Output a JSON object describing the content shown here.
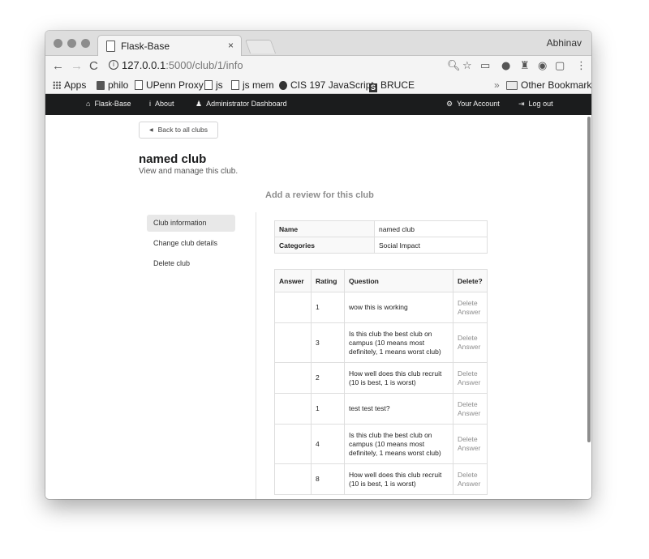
{
  "browser": {
    "tab_title": "Flask-Base",
    "tab_close": "×",
    "profile_name": "Abhinav",
    "url_host": "127.0.0.1",
    "url_rest": ":5000/club/1/info",
    "nav_back": "←",
    "nav_forward": "→",
    "nav_reload": "C",
    "icons": [
      "zoom-icon",
      "star-icon",
      "cast-icon",
      "extension-icon",
      "extension-icon",
      "extension-icon",
      "extension-icon",
      "menu-icon"
    ]
  },
  "bookmarks": {
    "items": [
      {
        "label": "Apps",
        "icon": "apps-grid-icon"
      },
      {
        "label": "philo",
        "icon": "facebook-icon"
      },
      {
        "label": "UPenn Proxy",
        "icon": "page-icon"
      },
      {
        "label": "js",
        "icon": "page-icon"
      },
      {
        "label": "js mem",
        "icon": "page-icon"
      },
      {
        "label": "CIS 197 JavaScript",
        "icon": "site-icon"
      },
      {
        "label": "BRUCE",
        "icon": "s-icon"
      }
    ],
    "overflow": "»",
    "other": "Other Bookmarks"
  },
  "navbar": {
    "home": "Flask-Base",
    "about": "About",
    "admin": "Administrator Dashboard",
    "account": "Your Account",
    "logout": "Log out"
  },
  "page": {
    "back_label": "Back to all clubs",
    "title": "named club",
    "subtitle": "View and manage this club.",
    "review_link": "Add a review for this club",
    "menu": [
      "Club information",
      "Change club details",
      "Delete club"
    ],
    "info_rows": [
      {
        "key": "Name",
        "value": "named club"
      },
      {
        "key": "Categories",
        "value": "Social Impact"
      }
    ],
    "qa_headers": [
      "Answer",
      "Rating",
      "Question",
      "Delete?"
    ],
    "qa_rows": [
      {
        "answer": "",
        "rating": "1",
        "question": "wow this is working",
        "delete": "Delete Answer"
      },
      {
        "answer": "",
        "rating": "3",
        "question": "Is this club the best club on campus (10 means most definitely, 1 means worst club)",
        "delete": "Delete Answer"
      },
      {
        "answer": "",
        "rating": "2",
        "question": "How well does this club recruit (10 is best, 1 is worst)",
        "delete": "Delete Answer"
      },
      {
        "answer": "",
        "rating": "1",
        "question": "test test test?",
        "delete": "Delete Answer"
      },
      {
        "answer": "",
        "rating": "4",
        "question": "Is this club the best club on campus (10 means most definitely, 1 means worst club)",
        "delete": "Delete Answer"
      },
      {
        "answer": "",
        "rating": "8",
        "question": "How well does this club recruit (10 is best, 1 is worst)",
        "delete": "Delete Answer"
      }
    ]
  }
}
